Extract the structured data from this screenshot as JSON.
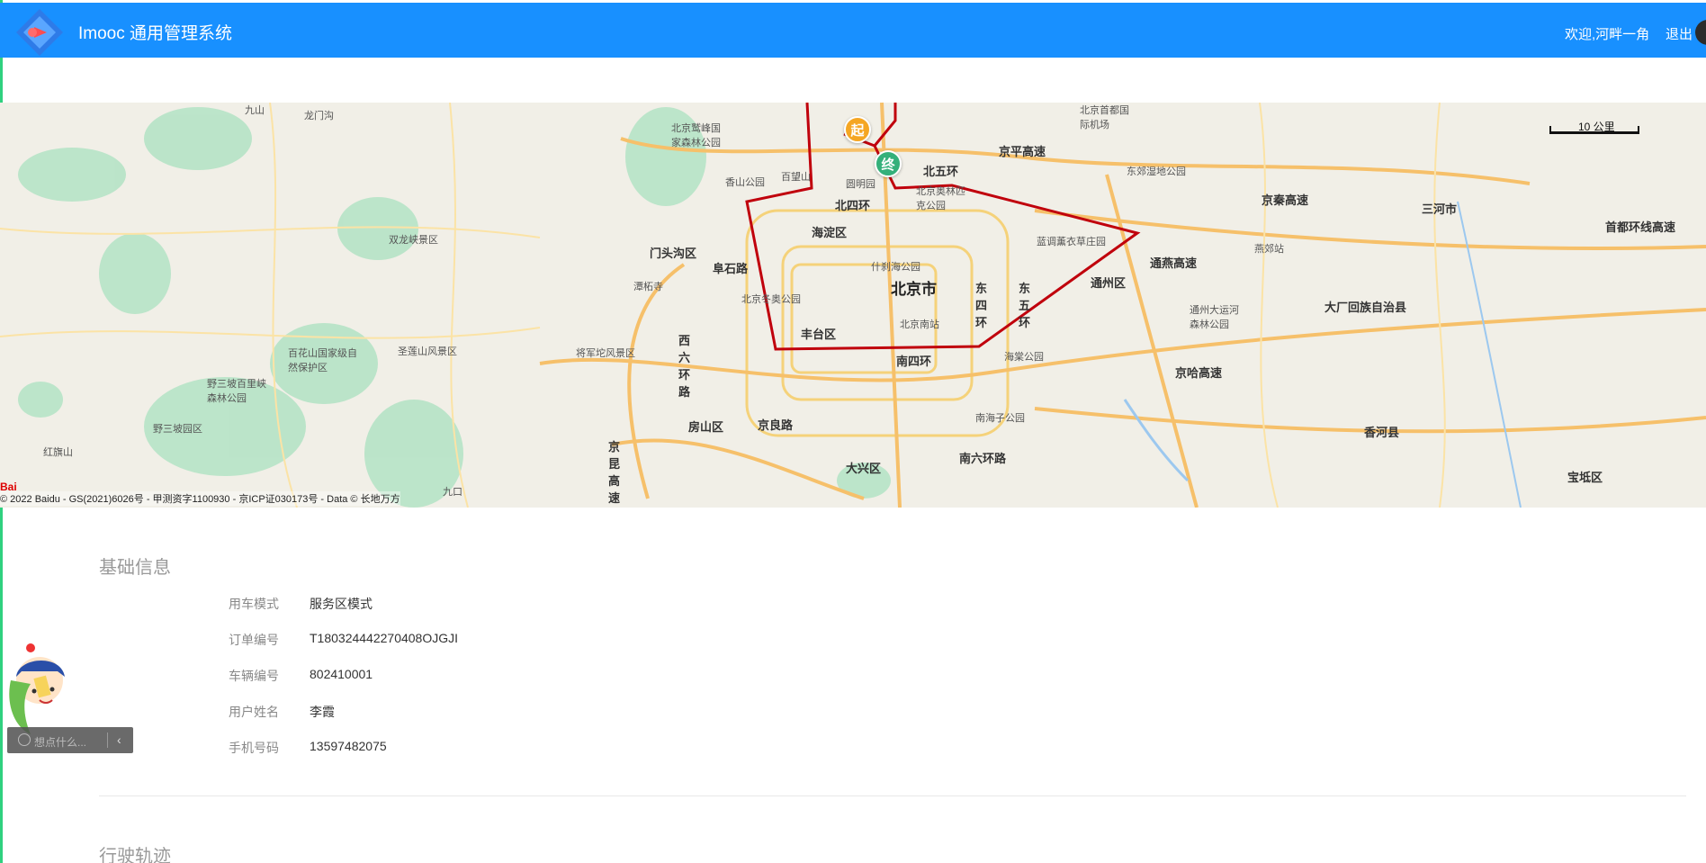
{
  "header": {
    "title": "Imooc 通用管理系统",
    "welcome": "欢迎,河畔一角",
    "logout": "退出",
    "brand_color": "#1890ff"
  },
  "map": {
    "scale_label": "10 公里",
    "copyright": "© 2022 Baidu - GS(2021)6026号 - 甲测资字1100930 - 京ICP证030173号 - Data © 长地万方",
    "baidu_logo": "Bai",
    "start_marker": "起",
    "end_marker": "终",
    "route_color": "#c0000c",
    "labels": {
      "city": "北京市",
      "haidian": "海淀区",
      "mentougou": "门头沟区",
      "fengtai": "丰台区",
      "fangshan": "房山区",
      "tongzhou": "通州区",
      "daxing": "大兴区",
      "dachang": "大厂回族自治县",
      "sanhe": "三河市",
      "xianghe": "香河县",
      "baodi": "宝坻区",
      "north4": "北四环",
      "north5": "北五环",
      "south4": "南四环",
      "east4": "东四环",
      "east5": "东五环",
      "west6": "西六环路",
      "south6": "南六环路",
      "jingping": "京平高速",
      "jingqin": "京秦高速",
      "jingha": "京哈高速",
      "tongyan": "通燕高速",
      "fushi": "阜石路",
      "jingliang": "京良路",
      "jingkun": "京昆高速",
      "shoudu": "首都环线高速",
      "beijing_south": "北京南站",
      "yanjiao": "燕郊站",
      "yuanmingyuan": "圆明园",
      "shichahai": "什刹海公园",
      "olympic": "北京奥林匹克公园",
      "xiangshan": "香山公园",
      "dongjiao": "东郊湿地公园",
      "lanyi": "蓝调薰衣草庄园",
      "winter_olympic": "北京冬奥公园",
      "tongzhou_canal": "通州大运河森林公园",
      "haitang": "海棠公园",
      "nanhaizi": "南海子公园",
      "jiulongfeng": "北京鹫峰国家森林公园",
      "shuanglong": "双龙峡景区",
      "tanzhe": "潭柘寺",
      "jiangjun": "将军坨风景区",
      "shengliancun": "圣莲山风景区",
      "baihua": "百花山国家级自然保护区",
      "yesanpo": "野三坡百里峡森林公园",
      "yesanpo2": "野三坡园区",
      "honghu": "红旗山",
      "jiushan": "九山",
      "longmen": "龙门沟",
      "jiukou": "九口",
      "baiwang": "百望山",
      "capital_airport": "北京首都国际机场"
    }
  },
  "basic_info": {
    "title": "基础信息",
    "rows": [
      {
        "label": "用车模式",
        "value": "服务区模式"
      },
      {
        "label": "订单编号",
        "value": "T180324442270408OJGJI"
      },
      {
        "label": "车辆编号",
        "value": "802410001"
      },
      {
        "label": "用户姓名",
        "value": "李霞"
      },
      {
        "label": "手机号码",
        "value": "13597482075"
      }
    ]
  },
  "track": {
    "title": "行驶轨迹"
  },
  "chat_widget": {
    "placeholder": "想点什么..."
  }
}
